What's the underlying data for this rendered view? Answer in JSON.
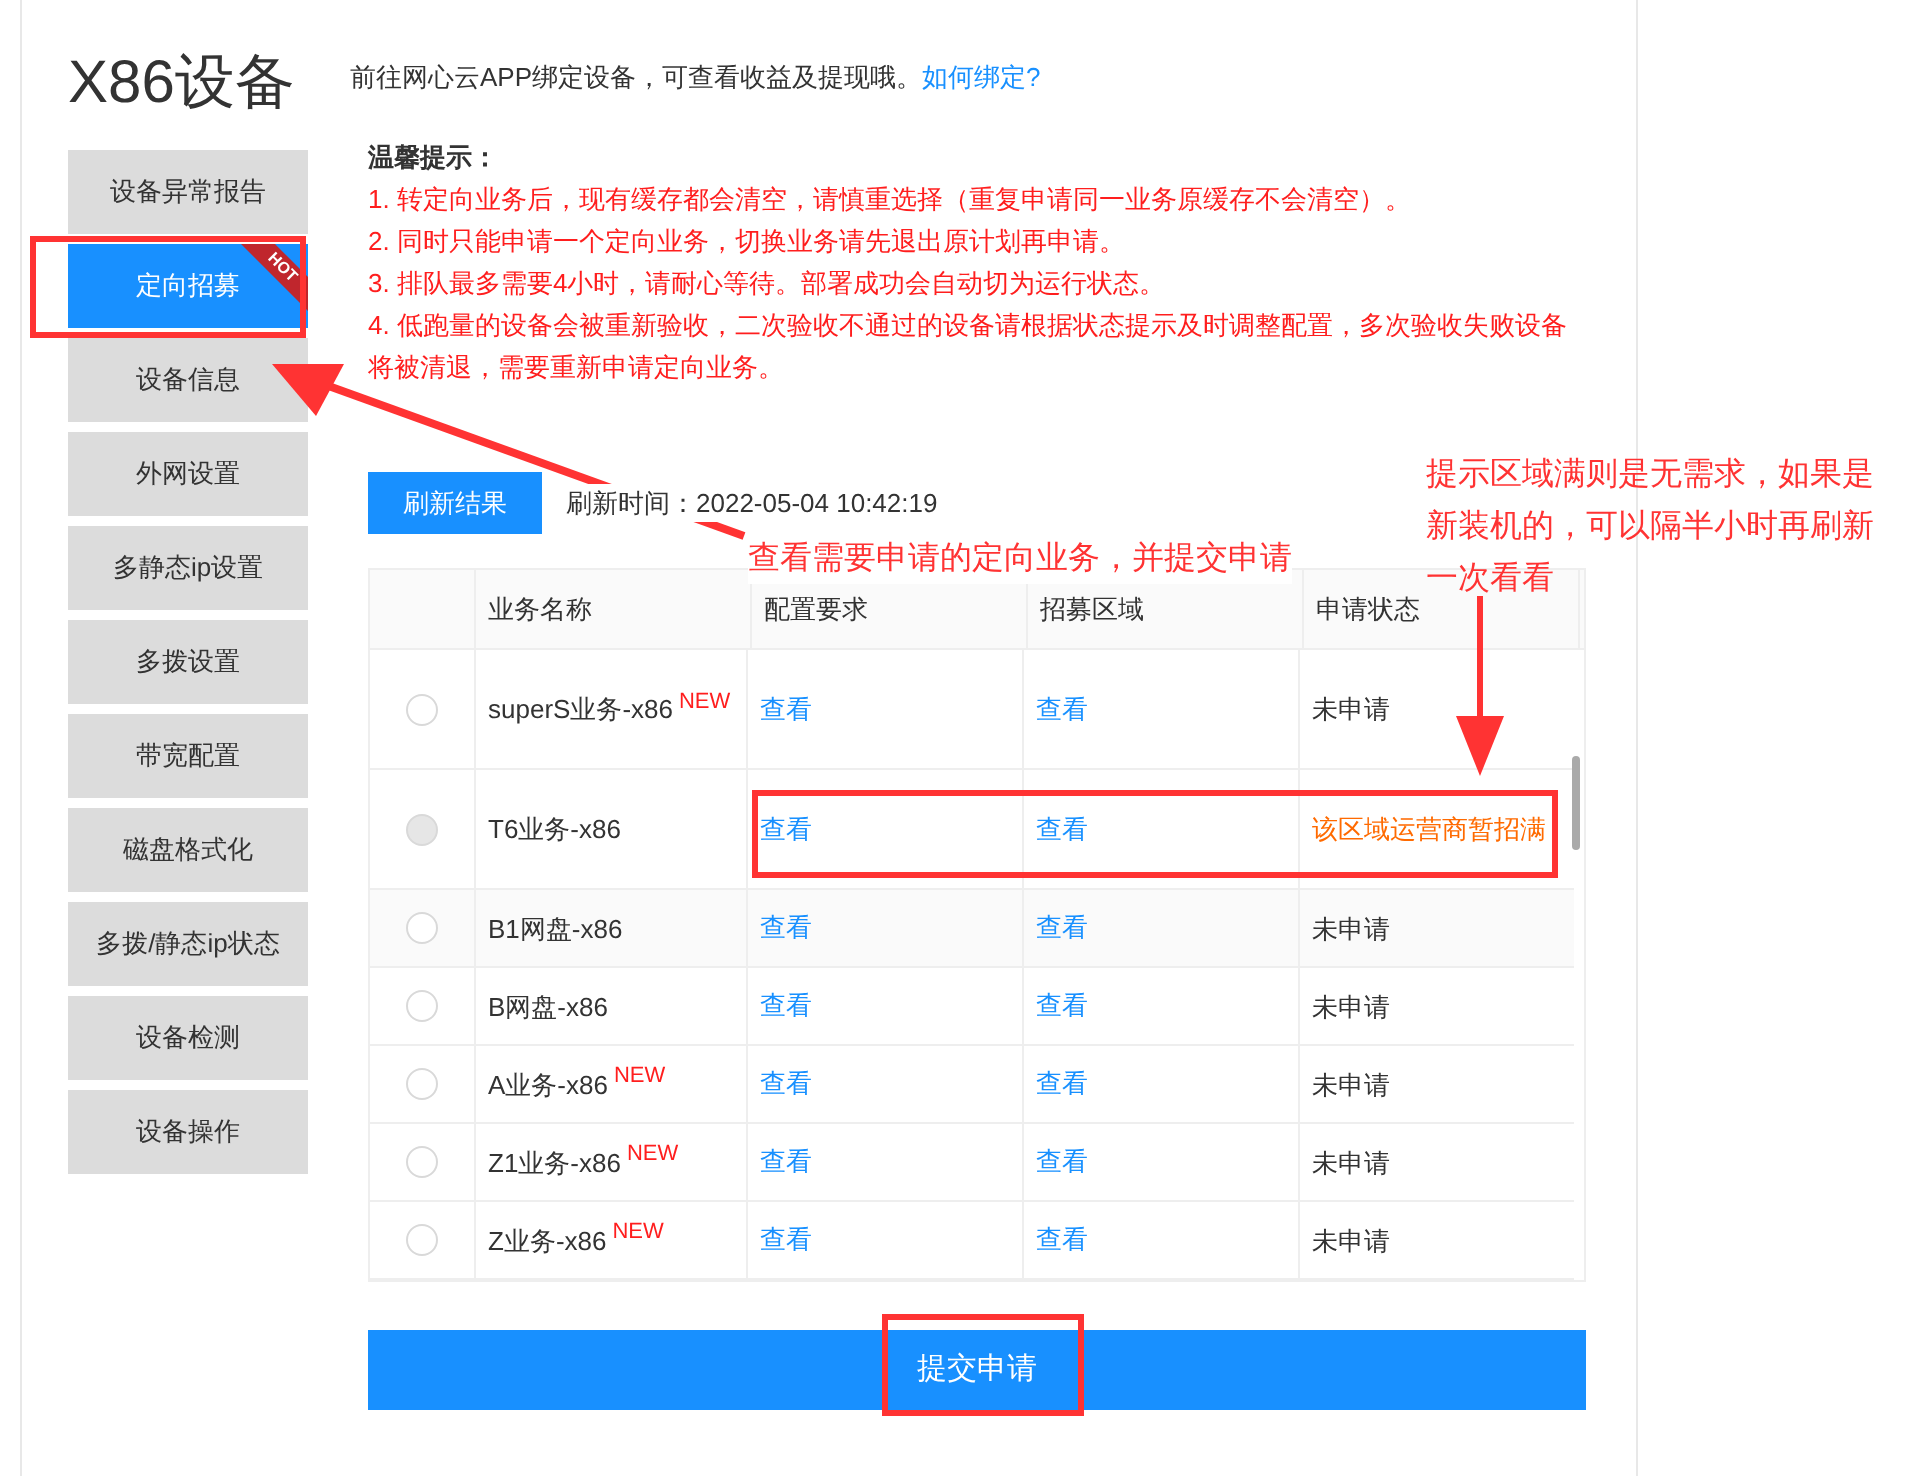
{
  "page_title": "X86设备",
  "bind_hint": {
    "text": "前往网心云APP绑定设备，可查看收益及提现哦。",
    "link": "如何绑定?"
  },
  "sidebar": {
    "items": [
      {
        "label": "设备异常报告",
        "selected": false
      },
      {
        "label": "定向招募",
        "selected": true,
        "badge": "HOT"
      },
      {
        "label": "设备信息",
        "selected": false
      },
      {
        "label": "外网设置",
        "selected": false
      },
      {
        "label": "多静态ip设置",
        "selected": false
      },
      {
        "label": "多拨设置",
        "selected": false
      },
      {
        "label": "带宽配置",
        "selected": false
      },
      {
        "label": "磁盘格式化",
        "selected": false
      },
      {
        "label": "多拨/静态ip状态",
        "selected": false
      },
      {
        "label": "设备检测",
        "selected": false
      },
      {
        "label": "设备操作",
        "selected": false
      }
    ]
  },
  "notice": {
    "title": "温馨提示：",
    "lines": [
      "1. 转定向业务后，现有缓存都会清空，请慎重选择（重复申请同一业务原缓存不会清空）。",
      "2. 同时只能申请一个定向业务，切换业务请先退出原计划再申请。",
      "3. 排队最多需要4小时，请耐心等待。部署成功会自动切为运行状态。",
      "4. 低跑量的设备会被重新验收，二次验收不通过的设备请根据状态提示及时调整配置，多次验收失败设备将被清退，需要重新申请定向业务。"
    ]
  },
  "refresh": {
    "button": "刷新结果",
    "time_label": "刷新时间：",
    "time": "2022-05-04 10:42:19"
  },
  "table": {
    "columns": [
      "业务名称",
      "配置要求",
      "招募区域",
      "申请状态"
    ],
    "rows": [
      {
        "name": "superS业务-x86",
        "new": "NEW",
        "config": "查看",
        "region": "查看",
        "status": "未申请",
        "kind": "open",
        "disabled": false,
        "selected": false
      },
      {
        "name": "T6业务-x86",
        "config": "查看",
        "region": "查看",
        "status": "该区域运营商暂招满",
        "kind": "full",
        "disabled": true,
        "selected": false
      },
      {
        "name": "B1网盘-x86",
        "config": "查看",
        "region": "查看",
        "status": "未申请",
        "kind": "open",
        "disabled": false,
        "selected": false
      },
      {
        "name": "B网盘-x86",
        "config": "查看",
        "region": "查看",
        "status": "未申请",
        "kind": "open",
        "disabled": false,
        "selected": false
      },
      {
        "name": "A业务-x86",
        "new": "NEW",
        "config": "查看",
        "region": "查看",
        "status": "未申请",
        "kind": "open",
        "disabled": false,
        "selected": false
      },
      {
        "name": "Z1业务-x86",
        "new": "NEW",
        "config": "查看",
        "region": "查看",
        "status": "未申请",
        "kind": "open",
        "disabled": false,
        "selected": false
      },
      {
        "name": "Z业务-x86",
        "new": "NEW",
        "config": "查看",
        "region": "查看",
        "status": "未申请",
        "kind": "open",
        "disabled": false,
        "selected": false
      }
    ]
  },
  "submit_button": "提交申请",
  "annotations": [
    "查看需要申请的定向业务，并提交申请",
    "提示区域满则是无需求，如果是新装机的，可以隔半小时再刷新一次看看"
  ]
}
